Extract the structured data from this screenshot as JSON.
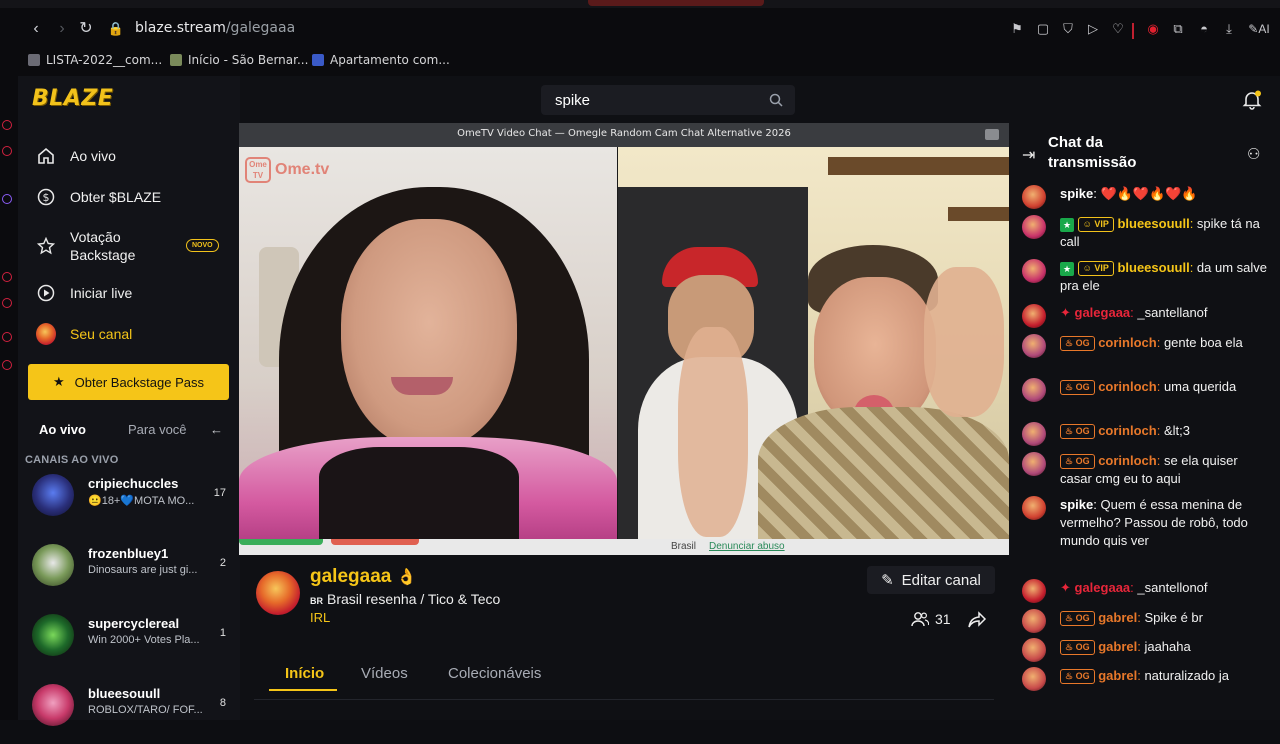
{
  "browser": {
    "url_domain": "blaze.stream",
    "url_path": "/galegaaa",
    "bookmarks": [
      "LISTA-2022__com...",
      "Início - São Bernar...",
      "Apartamento com..."
    ],
    "ai_label": "AI"
  },
  "app": {
    "logo": "BLAZE",
    "search_value": "spike",
    "sidebar": {
      "items": [
        {
          "label": "Ao vivo",
          "icon": "home-icon"
        },
        {
          "label": "Obter $BLAZE",
          "icon": "dollar-icon"
        },
        {
          "label": "Votação\nBackstage",
          "icon": "star-icon"
        },
        {
          "label": "Iniciar live",
          "icon": "play-icon"
        },
        {
          "label": "Seu canal",
          "icon": "avatar"
        }
      ],
      "novo_badge": "NOVO",
      "backstage_button": "Obter Backstage Pass",
      "feed_tabs": [
        "Ao vivo",
        "Para você"
      ],
      "live_heading": "CANAIS AO VIVO",
      "channels": [
        {
          "name": "cripiechuccles",
          "desc": "😐18+💙MOTA MO...",
          "count": "17"
        },
        {
          "name": "frozenbluey1",
          "desc": "Dinosaurs are just gi...",
          "count": "2"
        },
        {
          "name": "supercyclereal",
          "desc": "Win 2000+ Votes Pla...",
          "count": "1"
        },
        {
          "name": "blueesouull",
          "desc": "ROBLOX/TARO/ FOF...",
          "count": "8"
        }
      ]
    },
    "video": {
      "window_title": "OmeTV Video Chat — Omegle Random Cam Chat Alternative 2026",
      "logo_text": "Ome.tv",
      "footer_country": "Brasil",
      "footer_link": "Denunciar abuso"
    },
    "channel": {
      "name": "galegaaa",
      "flag": "BR",
      "title": "Brasil resenha / Tico & Teco",
      "category": "IRL",
      "edit_button": "Editar canal",
      "viewers": "31"
    },
    "tabs": [
      "Início",
      "Vídeos",
      "Colecionáveis"
    ],
    "chat": {
      "title": "Chat da transmissão",
      "messages": [
        {
          "user": "spike",
          "text": "❤️🔥❤️🔥❤️🔥",
          "badges": [],
          "color": "#ffffff"
        },
        {
          "user": "blueesouull",
          "text": "spike tá na call",
          "badges": [
            "VIP"
          ],
          "color": "#f5c518"
        },
        {
          "user": "blueesouull",
          "text": "da um salve pra ele",
          "badges": [
            "VIP"
          ],
          "color": "#f5c518"
        },
        {
          "user": "galegaaa",
          "text": "_santellanof",
          "badges": [],
          "color": "#e8263a"
        },
        {
          "user": "corinloch",
          "text": "gente boa ela",
          "badges": [
            "OG"
          ],
          "color": "#e8782a"
        },
        {
          "user": "corinloch",
          "text": "uma querida",
          "badges": [
            "OG"
          ],
          "color": "#e8782a"
        },
        {
          "user": "corinloch",
          "text": "&lt;3",
          "badges": [
            "OG"
          ],
          "color": "#e8782a"
        },
        {
          "user": "corinloch",
          "text": "se ela quiser casar cmg eu to aqui",
          "badges": [
            "OG"
          ],
          "color": "#e8782a"
        },
        {
          "user": "spike",
          "text": "Quem é essa menina de vermelho? Passou de robô, todo mundo quis ver",
          "badges": [],
          "color": "#ffffff"
        },
        {
          "user": "galegaaa",
          "text": "_santellonof",
          "badges": [],
          "color": "#e8263a"
        },
        {
          "user": "gabrel",
          "text": "Spike é br",
          "badges": [
            "OG"
          ],
          "color": "#e8782a"
        },
        {
          "user": "gabrel",
          "text": "jaahaha",
          "badges": [
            "OG"
          ],
          "color": "#e8782a"
        },
        {
          "user": "gabrel",
          "text": "naturalizado ja",
          "badges": [
            "OG"
          ],
          "color": "#e8782a"
        }
      ]
    }
  },
  "colors": {
    "accent": "#f5c518",
    "brand_red": "#e8263a",
    "og_orange": "#e8782a"
  }
}
